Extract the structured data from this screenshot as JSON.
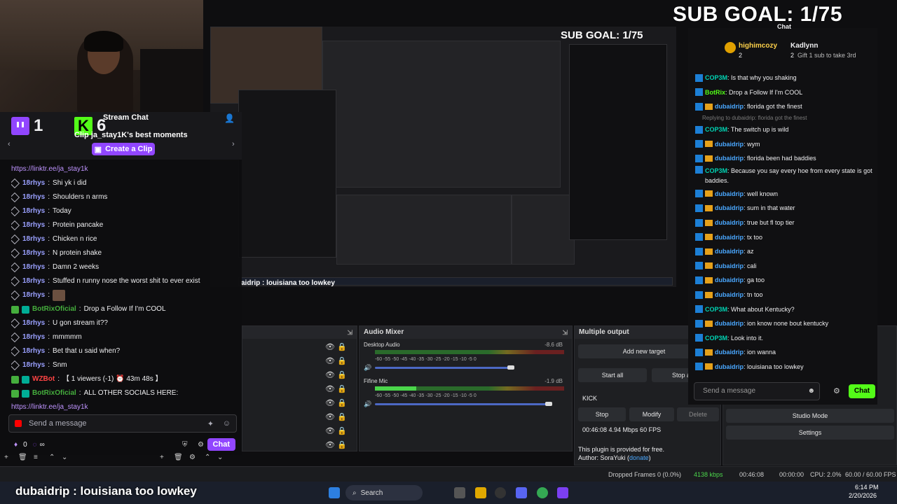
{
  "sub_goal": "SUB GOAL: 1/75",
  "left_chat": {
    "twitch_count": "1",
    "kick_count": "6",
    "title": "Stream Chat",
    "clip_title": "Clip ja_stay1K's best moments",
    "create_clip": "Create a Clip",
    "messages": [
      {
        "user": "",
        "text": "https://linktr.ee/ja_stay1k",
        "type": "link"
      },
      {
        "user": "18rhys",
        "text": "Shi yk i did"
      },
      {
        "user": "18rhys",
        "text": "Shoulders n arms"
      },
      {
        "user": "18rhys",
        "text": "Today"
      },
      {
        "user": "18rhys",
        "text": "Protein pancake"
      },
      {
        "user": "18rhys",
        "text": "Chicken n rice"
      },
      {
        "user": "18rhys",
        "text": "N protein shake"
      },
      {
        "user": "18rhys",
        "text": "Damn 2 weeks"
      },
      {
        "user": "18rhys",
        "text": "Stuffed n runny nose the worst shit to ever exist"
      },
      {
        "user": "18rhys",
        "text": "",
        "emote": true
      },
      {
        "user": "BotRixOficial",
        "text": "Drop a Follow If I'm COOL",
        "bot": true
      },
      {
        "user": "18rhys",
        "text": "U gon stream it??"
      },
      {
        "user": "18rhys",
        "text": "mmmmm"
      },
      {
        "user": "18rhys",
        "text": "Bet that u said when?"
      },
      {
        "user": "18rhys",
        "text": "Snm"
      },
      {
        "user": "WZBot",
        "text": "【 1 viewers (-1) ⏰ 43m 48s 】",
        "wz": true
      },
      {
        "user": "BotRixOficial",
        "text": "ALL OTHER SOCIALS HERE:",
        "bot": true
      },
      {
        "user": "",
        "text": "https://linktr.ee/ja_stay1k",
        "type": "link"
      }
    ],
    "send_placeholder": "Send a message",
    "points": "0",
    "infinity": "∞",
    "chat_button": "Chat"
  },
  "preview": {
    "sub_goal": "SUB GOAL: 1/75",
    "caption": "aidrip : louisiana too lowkey"
  },
  "audio_mixer": {
    "title": "Audio Mixer",
    "ticks": "-60 -55 -50 -45 -40 -35 -30 -25 -20 -15 -10 -5 0",
    "channels": [
      {
        "name": "Desktop Audio",
        "db": "-8.6 dB",
        "level": 0.0,
        "volume": 0.72
      },
      {
        "name": "Fifine Mic",
        "db": "-1.9 dB",
        "level": 0.22,
        "volume": 0.92
      }
    ]
  },
  "multiple_output": {
    "title": "Multiple output",
    "add_target": "Add new target",
    "start_all": "Start all",
    "stop_all": "Stop all",
    "target_name": "KICK",
    "stop": "Stop",
    "modify": "Modify",
    "delete": "Delete",
    "stats": "00:46:08 4.94 Mbps 60 FPS",
    "free_note": "This plugin is provided for free.",
    "author": "Author: SoraYuki (",
    "donate": "donate",
    "author_end": ")"
  },
  "controls": {
    "studio_mode": "Studio Mode",
    "settings": "Settings"
  },
  "right_chat": {
    "title": "Chat",
    "top1_name": "highimcozy",
    "top1_count": "2",
    "top2_name": "Kadlynn",
    "top2_count": "2",
    "gift_text": "Gift 1 sub to take 3rd",
    "messages": [
      {
        "user": "COP3M",
        "text": "Is that why you shaking",
        "color": "blue"
      },
      {
        "user": "BotRix",
        "text": "Drop a Follow If I'm COOL",
        "color": "green"
      },
      {
        "user": "dubaidrip",
        "text": "florida got the finest",
        "color": "blue",
        "crown": true
      },
      {
        "reply": "Replying to dubaidrip: florida got the finest"
      },
      {
        "user": "COP3M",
        "text": "The switch up is wild",
        "color": "blue"
      },
      {
        "user": "dubaidrip",
        "text": "wym",
        "color": "blue",
        "crown": true
      },
      {
        "user": "dubaidrip",
        "text": "florida been had baddies",
        "color": "blue",
        "crown": true
      },
      {
        "user": "COP3M",
        "text": "Because you say every hoe from every state is got baddies.",
        "color": "blue",
        "tall": true
      },
      {
        "user": "dubaidrip",
        "text": "well known",
        "color": "blue",
        "crown": true
      },
      {
        "user": "dubaidrip",
        "text": "sum in that water",
        "color": "blue",
        "crown": true
      },
      {
        "user": "dubaidrip",
        "text": "true but fl top tier",
        "color": "blue",
        "crown": true
      },
      {
        "user": "dubaidrip",
        "text": "tx too",
        "color": "blue",
        "crown": true
      },
      {
        "user": "dubaidrip",
        "text": "az",
        "color": "blue",
        "crown": true
      },
      {
        "user": "dubaidrip",
        "text": "cali",
        "color": "blue",
        "crown": true
      },
      {
        "user": "dubaidrip",
        "text": "ga too",
        "color": "blue",
        "crown": true
      },
      {
        "user": "dubaidrip",
        "text": "tn too",
        "color": "blue",
        "crown": true
      },
      {
        "user": "COP3M",
        "text": "What about Kentucky?",
        "color": "blue"
      },
      {
        "user": "dubaidrip",
        "text": "ion know none bout kentucky",
        "color": "blue",
        "crown": true
      },
      {
        "user": "COP3M",
        "text": "Look into it.",
        "color": "blue"
      },
      {
        "user": "dubaidrip",
        "text": "ion wanna",
        "color": "blue",
        "crown": true
      },
      {
        "user": "dubaidrip",
        "text": "louisiana too lowkey",
        "color": "blue",
        "crown": true
      }
    ],
    "send_placeholder": "Send a message",
    "chat_button": "Chat"
  },
  "status": {
    "dropped": "Dropped Frames 0 (0.0%)",
    "bitrate": "4138 kbps",
    "time1": "00:46:08",
    "time2": "00:00:00",
    "cpu": "CPU: 2.0%",
    "fps": "60.00 / 60.00 FPS"
  },
  "taskbar": {
    "search": "Search",
    "time": "6:14 PM",
    "date": "2/20/2026"
  },
  "caption": "dubaidrip : louisiana too lowkey"
}
